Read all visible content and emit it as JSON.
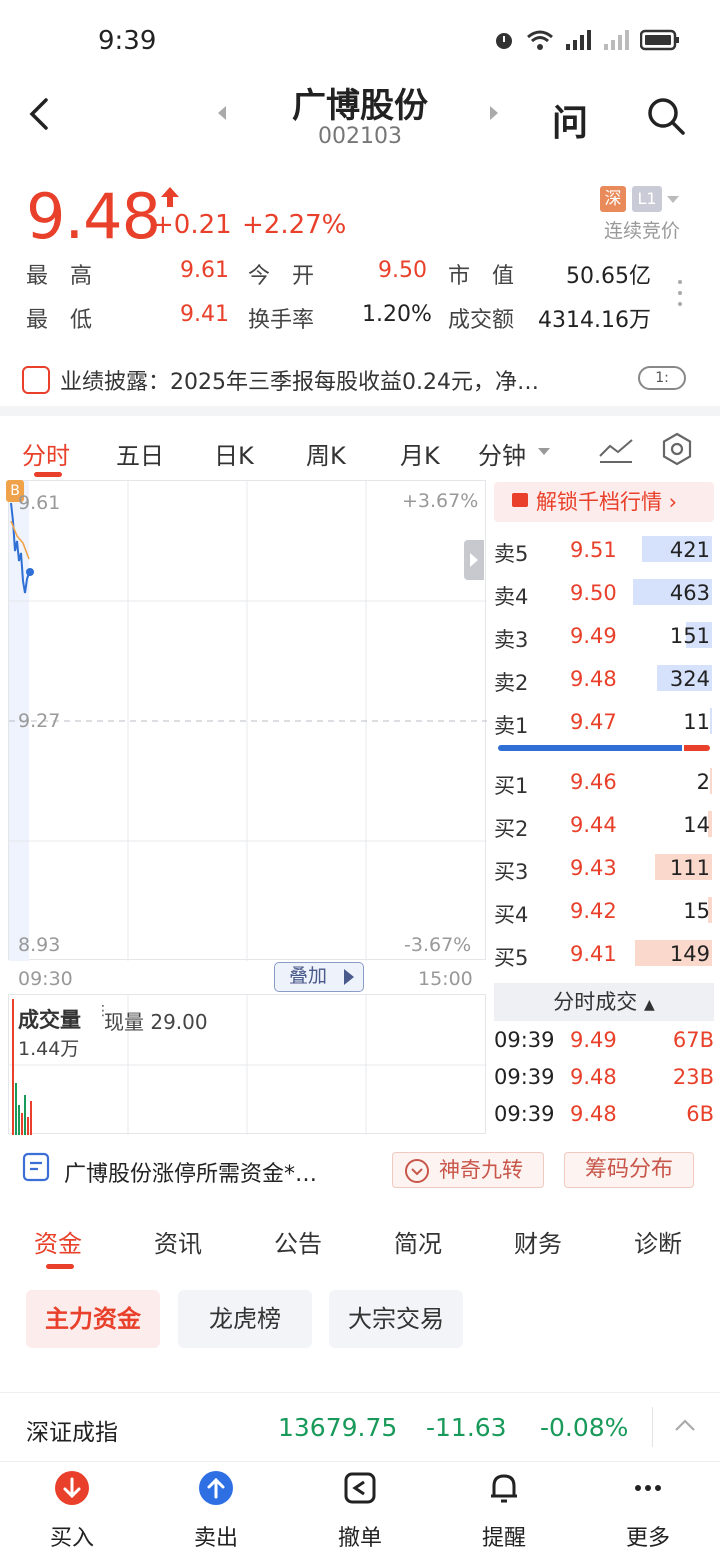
{
  "status": {
    "time": "9:39"
  },
  "header": {
    "title": "广博股份",
    "code": "002103",
    "ask_icon_label": "问"
  },
  "quote": {
    "price": "9.48",
    "change": "+0.21",
    "change_pct": "+2.27%",
    "exchange_badge": "深",
    "level_badge": "L1",
    "auction_state": "连续竞价",
    "stats": [
      {
        "label": "最　高",
        "value": "9.61"
      },
      {
        "label": "今　开",
        "value": "9.50"
      },
      {
        "label": "市　值",
        "value": "50.65亿"
      },
      {
        "label": "最　低",
        "value": "9.41"
      },
      {
        "label": "换手率",
        "value": "1.20%"
      },
      {
        "label": "成交额",
        "value": "4314.16万"
      }
    ]
  },
  "disclosure": {
    "text": "业绩披露：2025年三季报每股收益0.24元，净…",
    "badge": "1:"
  },
  "chart_tabs": [
    "分时",
    "五日",
    "日K",
    "周K",
    "月K",
    "分钟"
  ],
  "chart": {
    "price_high": "9.61",
    "price_mid": "9.27",
    "price_low": "8.93",
    "pct_high": "+3.67%",
    "pct_low": "-3.67%",
    "time_start": "09:30",
    "time_end": "15:00",
    "overlay_btn": "叠加",
    "marker": "B",
    "volume_label": "成交量",
    "current_volume": "现量 29.00",
    "volume_axis": "1.44万"
  },
  "order_book": {
    "unlock": "解锁千档行情",
    "asks": [
      {
        "label": "卖5",
        "price": "9.51",
        "vol": "421",
        "fill": 0.32
      },
      {
        "label": "卖4",
        "price": "9.50",
        "vol": "463",
        "fill": 0.36
      },
      {
        "label": "卖3",
        "price": "9.49",
        "vol": "151",
        "fill": 0.12
      },
      {
        "label": "卖2",
        "price": "9.48",
        "vol": "324",
        "fill": 0.25
      },
      {
        "label": "卖1",
        "price": "9.47",
        "vol": "11",
        "fill": 0.01
      }
    ],
    "bids": [
      {
        "label": "买1",
        "price": "9.46",
        "vol": "2",
        "fill": 0.01
      },
      {
        "label": "买2",
        "price": "9.44",
        "vol": "14",
        "fill": 0.02
      },
      {
        "label": "买3",
        "price": "9.43",
        "vol": "111",
        "fill": 0.26
      },
      {
        "label": "买4",
        "price": "9.42",
        "vol": "15",
        "fill": 0.02
      },
      {
        "label": "买5",
        "price": "9.41",
        "vol": "149",
        "fill": 0.35
      }
    ],
    "bid_ask_ratio": 0.87,
    "ticks_header": "分时成交",
    "ticks": [
      {
        "time": "09:39",
        "price": "9.49",
        "vol": "67B"
      },
      {
        "time": "09:39",
        "price": "9.48",
        "vol": "23B"
      },
      {
        "time": "09:39",
        "price": "9.48",
        "vol": "6B"
      }
    ]
  },
  "promo": {
    "text": "广博股份涨停所需资金*…",
    "btn1": "神奇九转",
    "btn2": "筹码分布"
  },
  "bottom_tabs": [
    "资金",
    "资讯",
    "公告",
    "简况",
    "财务",
    "诊断"
  ],
  "chips": [
    "主力资金",
    "龙虎榜",
    "大宗交易"
  ],
  "index": {
    "name": "深证成指",
    "value": "13679.75",
    "change": "-11.63",
    "pct": "-0.08%"
  },
  "nav": [
    "买入",
    "卖出",
    "撤单",
    "提醒",
    "更多"
  ],
  "colors": {
    "up": "#e8402a",
    "down": "#1a9a5a",
    "line": "#2f6fd6"
  }
}
